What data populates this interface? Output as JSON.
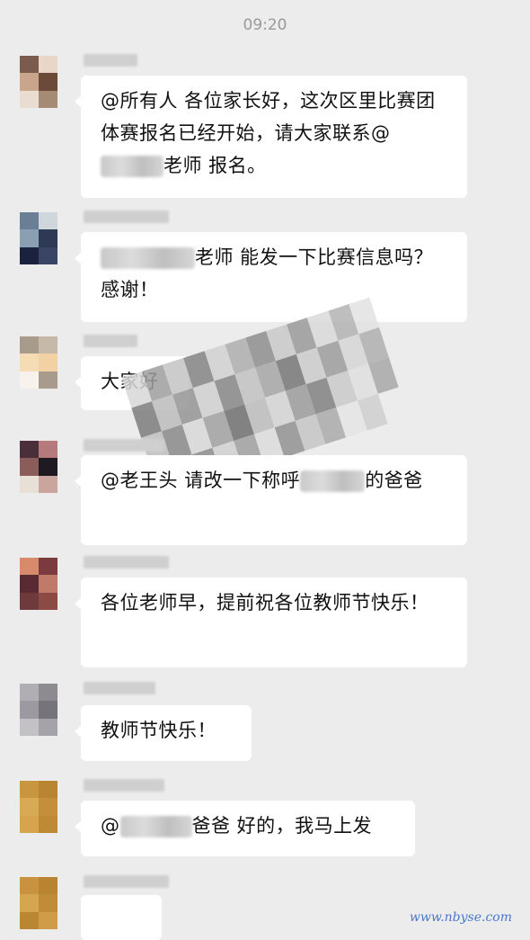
{
  "timestamp": "09:20",
  "messages": [
    {
      "parts": [
        "@所有人 各位家长好，这次区里比赛团体赛报名已经开始，请大家联系@",
        "REDACT",
        "老师 报名。"
      ]
    },
    {
      "parts": [
        "REDACT",
        "老师 能发一下比赛信息吗？感谢！"
      ]
    },
    {
      "parts": [
        "大家好"
      ]
    },
    {
      "parts": [
        "@老王头 请改一下称呼",
        "REDACT",
        "的爸爸"
      ]
    },
    {
      "parts": [
        "各位老师早，提前祝各位教师节快乐！"
      ]
    },
    {
      "parts": [
        "教师节快乐！"
      ]
    },
    {
      "parts": [
        "@",
        "REDACT",
        "爸爸 好的，我马上发"
      ]
    }
  ],
  "watermark": "www.nbyse.com",
  "colors": {
    "background": "#ececec",
    "bubble": "#ffffff",
    "time": "#9a9a9a"
  }
}
